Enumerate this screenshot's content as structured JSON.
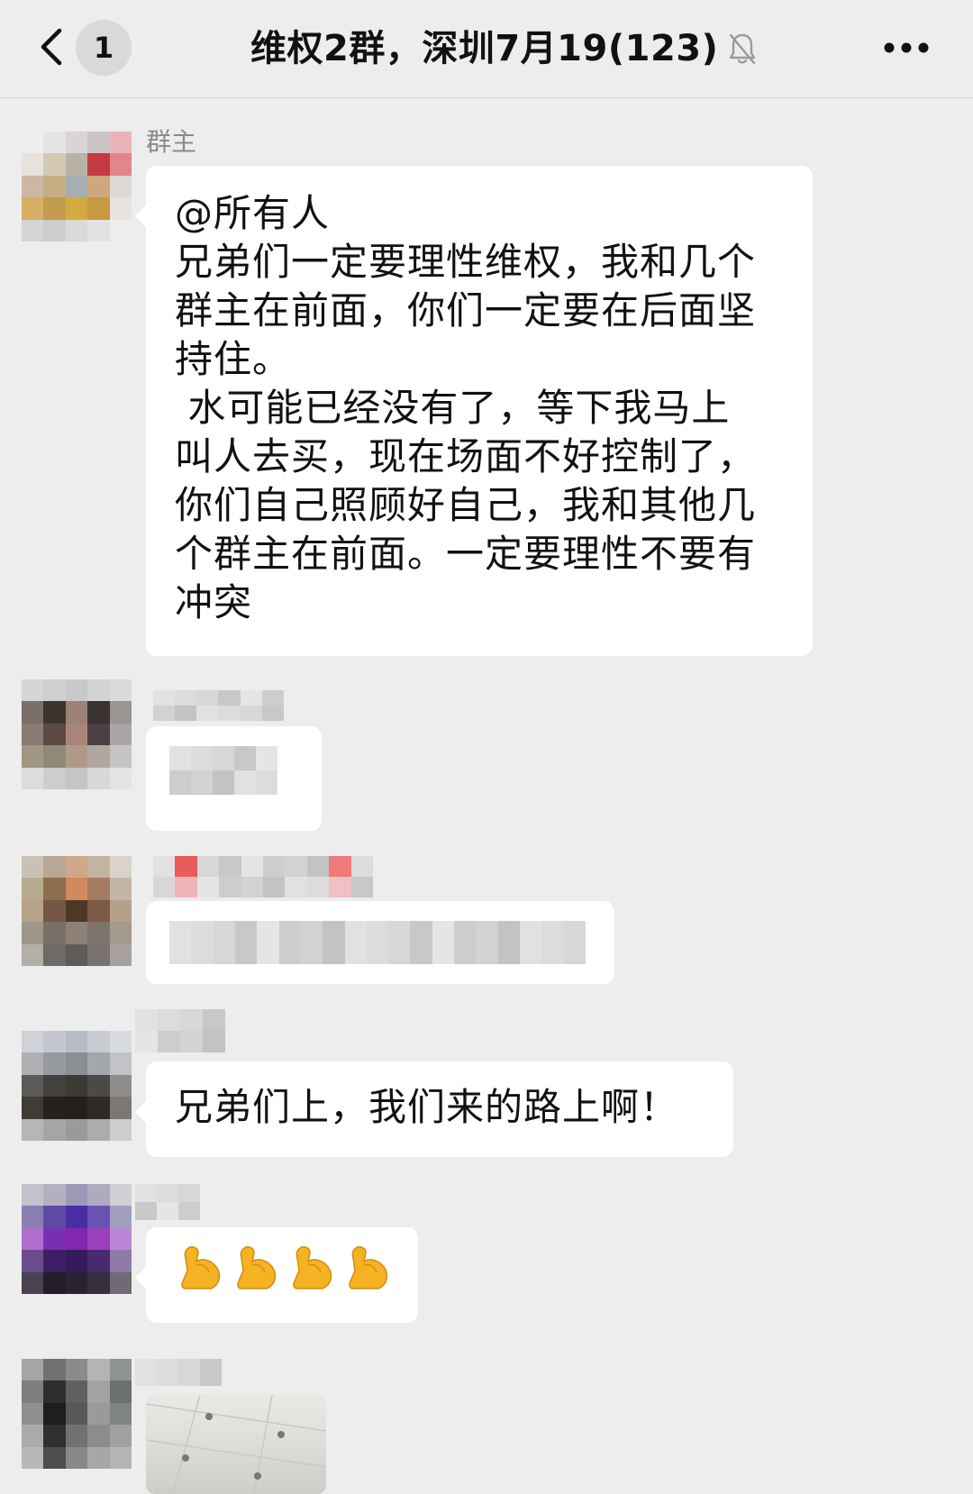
{
  "header": {
    "unread_count": "1",
    "title": "维权2群，深圳7月19(123)"
  },
  "messages": [
    {
      "sender": "群主",
      "lines": [
        "@所有人",
        "兄弟们一定要理性维权，我和几个",
        "群主在前面，你们一定要在后面坚",
        "持住。",
        " 水可能已经没有了，等下我马上",
        "叫人去买，现在场面不好控制了，",
        "你们自己照顾好自己，我和其他几",
        "个群主在前面。一定要理性不要有",
        "冲突"
      ]
    },
    {
      "sender": "",
      "text": ""
    },
    {
      "sender": "",
      "text": ""
    },
    {
      "sender": "",
      "text": "兄弟们上，我们来的路上啊！"
    },
    {
      "sender": "",
      "emoji_count": 4,
      "emoji_name": "flexed-biceps"
    },
    {
      "sender": "",
      "image": "photo-thumbnail"
    }
  ],
  "colors": {
    "background": "#ededed",
    "bubble": "#ffffff",
    "sender_name": "#8a8a8a",
    "badge": "#d9d9d9"
  },
  "icons": [
    "back-chevron-icon",
    "mute-bell-icon",
    "more-dots-icon",
    "flexed-biceps-emoji"
  ]
}
